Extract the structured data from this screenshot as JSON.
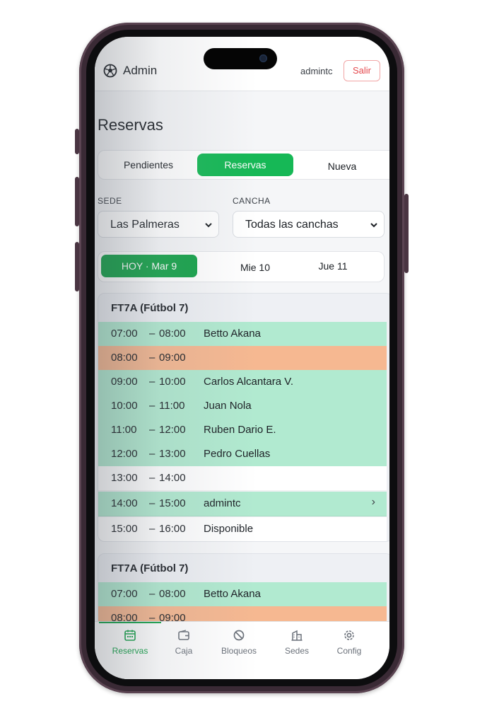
{
  "header": {
    "brand": "Admin",
    "user": "admintc",
    "logout_label": "Salir"
  },
  "page_title": "Reservas",
  "tabs": [
    {
      "label": "Pendientes",
      "active": false
    },
    {
      "label": "Reservas",
      "active": true
    },
    {
      "label": "Nueva",
      "active": false
    }
  ],
  "filters": {
    "sede_label": "SEDE",
    "sede_value": "Las Palmeras",
    "cancha_label": "CANCHA",
    "cancha_value": "Todas las canchas"
  },
  "days": [
    {
      "label": "HOY · Mar 9",
      "active": true
    },
    {
      "label": "Mie 10",
      "active": false
    },
    {
      "label": "Jue 11",
      "active": false
    }
  ],
  "courts": [
    {
      "title": "FT7A (Fútbol 7)",
      "slots": [
        {
          "start": "07:00",
          "sep": "–",
          "end": "08:00",
          "name": "Betto Akana",
          "status": "booked"
        },
        {
          "start": "08:00",
          "sep": "–",
          "end": "09:00",
          "name": "",
          "status": "blocked"
        },
        {
          "start": "09:00",
          "sep": "–",
          "end": "10:00",
          "name": "Carlos Alcantara V.",
          "status": "booked"
        },
        {
          "start": "10:00",
          "sep": "–",
          "end": "11:00",
          "name": "Juan Nola",
          "status": "booked"
        },
        {
          "start": "11:00",
          "sep": "–",
          "end": "12:00",
          "name": "Ruben Dario E.",
          "status": "booked"
        },
        {
          "start": "12:00",
          "sep": "–",
          "end": "13:00",
          "name": "Pedro Cuellas",
          "status": "booked"
        },
        {
          "start": "13:00",
          "sep": "–",
          "end": "14:00",
          "name": "",
          "status": "free"
        },
        {
          "start": "14:00",
          "sep": "–",
          "end": "15:00",
          "name": "admintc",
          "status": "booked",
          "arrow": "›"
        },
        {
          "start": "15:00",
          "sep": "–",
          "end": "16:00",
          "name": "Disponible",
          "status": "free"
        }
      ]
    },
    {
      "title": "FT7A (Fútbol 7)",
      "slots": [
        {
          "start": "07:00",
          "sep": "–",
          "end": "08:00",
          "name": "Betto Akana",
          "status": "booked"
        },
        {
          "start": "08:00",
          "sep": "–",
          "end": "09:00",
          "name": "",
          "status": "blocked"
        }
      ]
    }
  ],
  "nav": [
    {
      "label": "Reservas",
      "icon": "calendar-icon",
      "active": true
    },
    {
      "label": "Caja",
      "icon": "wallet-icon",
      "active": false
    },
    {
      "label": "Bloqueos",
      "icon": "block-icon",
      "active": false
    },
    {
      "label": "Sedes",
      "icon": "building-icon",
      "active": false
    },
    {
      "label": "Config",
      "icon": "gear-icon",
      "active": false
    }
  ],
  "colors": {
    "accent": "#16b856",
    "booked": "#b1ead0",
    "blocked": "#f6b891",
    "free": "#ffffff",
    "logout": "#e5484d"
  }
}
